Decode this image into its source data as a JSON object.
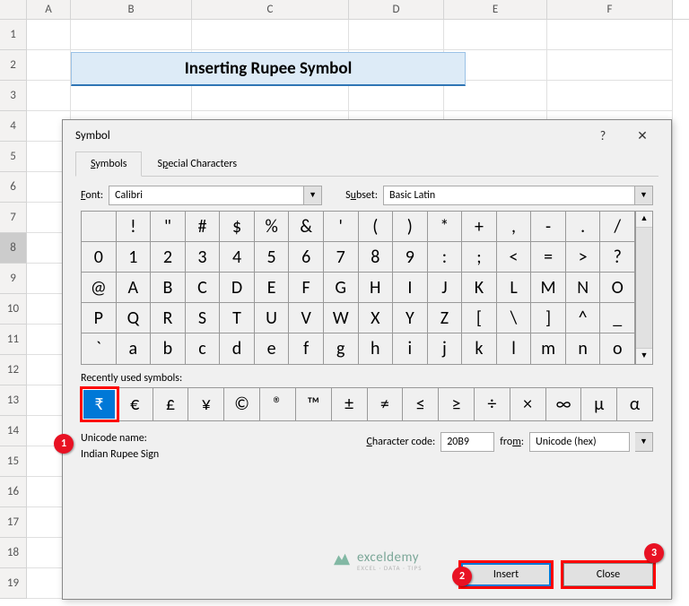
{
  "columns": [
    "A",
    "B",
    "C",
    "D",
    "E",
    "F"
  ],
  "rows_count": 19,
  "title_text": "Inserting Rupee Symbol",
  "dialog": {
    "title": "Symbol",
    "help": "?",
    "close_glyph": "✕",
    "tabs": {
      "symbols": "Symbols",
      "special": "Special Characters"
    },
    "font_label": "Font:",
    "font_value": "Calibri",
    "subset_label": "Subset:",
    "subset_value": "Basic Latin",
    "grid": [
      [
        " ",
        "!",
        "\"",
        "#",
        "$",
        "%",
        "&",
        "'",
        "(",
        ")",
        "*",
        "+",
        ",",
        "-",
        ".",
        "/"
      ],
      [
        "0",
        "1",
        "2",
        "3",
        "4",
        "5",
        "6",
        "7",
        "8",
        "9",
        ":",
        ";",
        "<",
        "=",
        ">",
        "?"
      ],
      [
        "@",
        "A",
        "B",
        "C",
        "D",
        "E",
        "F",
        "G",
        "H",
        "I",
        "J",
        "K",
        "L",
        "M",
        "N",
        "O"
      ],
      [
        "P",
        "Q",
        "R",
        "S",
        "T",
        "U",
        "V",
        "W",
        "X",
        "Y",
        "Z",
        "[",
        "\\",
        "]",
        "^",
        "_"
      ],
      [
        "`",
        "a",
        "b",
        "c",
        "d",
        "e",
        "f",
        "g",
        "h",
        "i",
        "j",
        "k",
        "l",
        "m",
        "n",
        "o"
      ]
    ],
    "recent_label": "Recently used symbols:",
    "recent": [
      "₹",
      "€",
      "£",
      "¥",
      "©",
      "®",
      "™",
      "±",
      "≠",
      "≤",
      "≥",
      "÷",
      "×",
      "∞",
      "µ",
      "α"
    ],
    "unicode_label": "Unicode name:",
    "unicode_name": "Indian Rupee Sign",
    "charcode_label": "Character code:",
    "charcode_value": "20B9",
    "from_label": "from:",
    "from_value": "Unicode (hex)",
    "insert_btn": "Insert",
    "close_btn": "Close"
  },
  "badges": {
    "b1": "1",
    "b2": "2",
    "b3": "3"
  },
  "watermark": {
    "name": "exceldemy",
    "sub": "EXCEL · DATA · TIPS"
  }
}
